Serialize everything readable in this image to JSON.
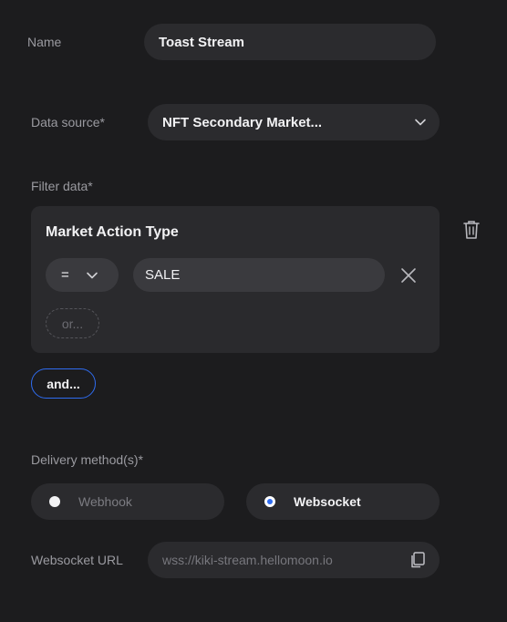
{
  "form": {
    "name_label": "Name",
    "name_value": "Toast Stream",
    "data_source_label": "Data source*",
    "data_source_value": "NFT Secondary Market...",
    "filter_label": "Filter data*",
    "filter": {
      "title": "Market Action Type",
      "operator": "=",
      "value": "SALE",
      "or_label": "or..."
    },
    "and_label": "and...",
    "delivery_label": "Delivery method(s)*",
    "delivery_options": [
      {
        "label": "Webhook",
        "selected": false
      },
      {
        "label": "Websocket",
        "selected": true
      }
    ],
    "websocket_url_label": "Websocket URL",
    "websocket_url_placeholder": "wss://kiki-stream.hellomoon.io"
  },
  "icons": [
    "chevron-down-icon",
    "close-icon",
    "trash-icon",
    "copy-icon"
  ],
  "colors": {
    "accent": "#2f6cf0",
    "background": "#1c1c1e",
    "field": "#2b2b2e"
  }
}
